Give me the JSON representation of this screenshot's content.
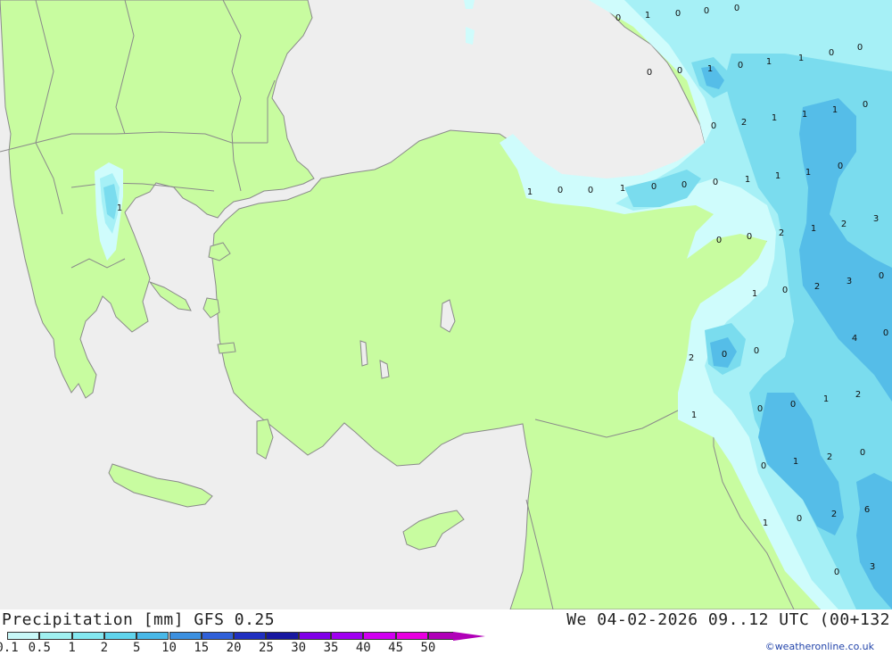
{
  "footer": {
    "title": "Precipitation [mm] GFS 0.25",
    "datetime": "We 04-02-2026 09..12 UTC (00+132",
    "credit": "©weatheronline.co.uk"
  },
  "legend": {
    "labels": [
      "0.1",
      "0.5",
      "1",
      "2",
      "5",
      "10",
      "15",
      "20",
      "25",
      "30",
      "35",
      "40",
      "45",
      "50"
    ],
    "colors": [
      "#c8f8f8",
      "#a0f0f0",
      "#84e8f0",
      "#60d4ec",
      "#48b8e8",
      "#3c90e0",
      "#3060d8",
      "#2030c0",
      "#1818a0",
      "#8000e8",
      "#a000f0",
      "#d000f0",
      "#e800e0",
      "#b000b8"
    ]
  },
  "map": {
    "colors": {
      "sea": "#eeeeee",
      "land": "#c8fca0",
      "border": "#8a8a8a",
      "precip_light": "#cffcfc",
      "precip_1": "#a6f0f6",
      "precip_2": "#7adcee",
      "precip_5": "#55bde8"
    },
    "values": [
      "0",
      "1",
      "0",
      "0",
      "0",
      "0",
      "0",
      "1",
      "0",
      "1",
      "1",
      "0",
      "0",
      "2",
      "0",
      "1",
      "1",
      "1",
      "0",
      "1",
      "0",
      "0",
      "1",
      "0",
      "0",
      "0",
      "1",
      "1",
      "1",
      "0",
      "0",
      "0",
      "2",
      "1",
      "2",
      "3",
      "2",
      "3",
      "0",
      "1",
      "0",
      "4",
      "0",
      "2",
      "0",
      "0",
      "1",
      "2",
      "1",
      "0",
      "0",
      "0",
      "1",
      "2",
      "0",
      "1",
      "0",
      "2",
      "6",
      "0",
      "3",
      "1"
    ]
  }
}
